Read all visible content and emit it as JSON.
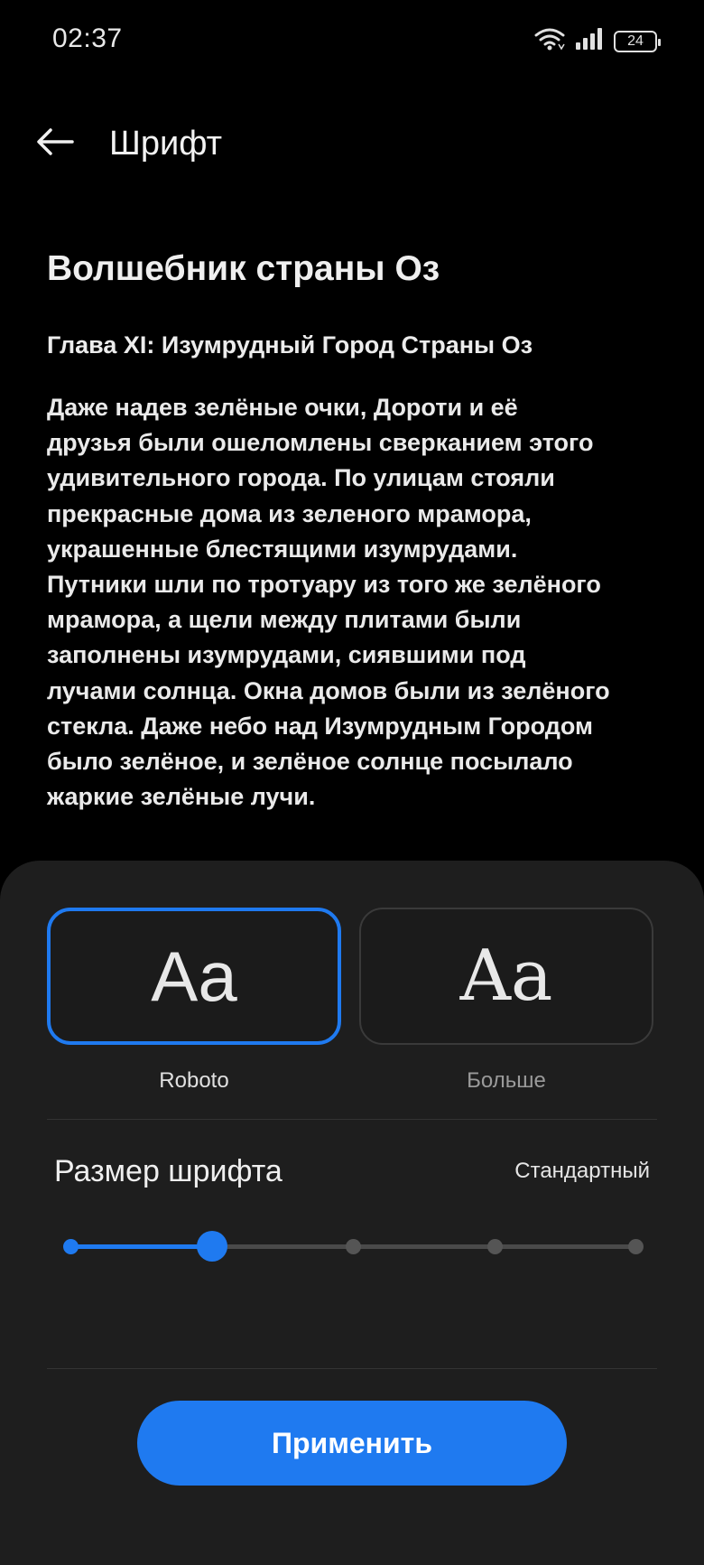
{
  "status_bar": {
    "time": "02:37",
    "battery": "24",
    "icons": [
      "wifi-icon",
      "signal-icon",
      "battery-icon"
    ]
  },
  "app_bar": {
    "back_icon": "arrow-left-icon",
    "title": "Шрифт"
  },
  "preview": {
    "book_title": "Волшебник страны Оз",
    "chapter_title": "Глава XI: Изумрудный Город Страны Оз",
    "body_lines": [
      "Даже надев зелёные очки, Дороти и её",
      "друзья были ошеломлены сверканием этого",
      "удивительного города. По улицам стояли",
      "прекрасные дома из зеленого мрамора,",
      "украшенные блестящими изумрудами.",
      "Путники шли по тротуару из того же зелёного",
      "мрамора, а щели между плитами были",
      "заполнены изумрудами, сиявшими под",
      "лучами солнца. Окна домов были из зелёного",
      "стекла. Даже небо над Изумрудным Городом",
      "было зелёное, и зелёное солнце посылало",
      "жаркие зелёные лучи."
    ]
  },
  "font_picker": {
    "options": [
      {
        "sample": "Aa",
        "label": "Roboto",
        "selected": true
      },
      {
        "sample": "Aa",
        "label": "Больше",
        "selected": false
      }
    ]
  },
  "font_size": {
    "title": "Размер шрифта",
    "value_label": "Стандартный",
    "steps": 5,
    "selected_step": 1
  },
  "apply_button": {
    "label": "Применить"
  },
  "colors": {
    "accent": "#1f7af0",
    "background": "#000000",
    "sheet": "#1e1e1e",
    "track": "#4a4a4a"
  }
}
